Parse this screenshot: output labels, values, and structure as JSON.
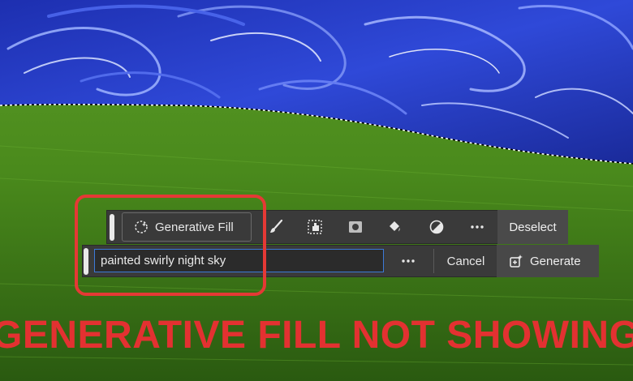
{
  "toolbar": {
    "generative_fill_label": "Generative Fill",
    "deselect_label": "Deselect",
    "prompt_value": "painted swirly night sky",
    "cancel_label": "Cancel",
    "generate_label": "Generate",
    "tools": [
      "brush-icon",
      "select-subject-icon",
      "mask-icon",
      "fill-bucket-icon",
      "invert-icon",
      "more-icon"
    ]
  },
  "headline": "GENERATIVE FILL NOT SHOWING",
  "colors": {
    "highlight": "#e53935",
    "headline": "#e33131",
    "toolbar_bg": "#3a3a3a",
    "prompt_border": "#3c7ad8"
  }
}
